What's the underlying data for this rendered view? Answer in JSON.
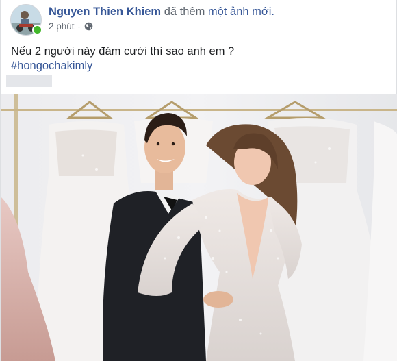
{
  "post": {
    "author": "Nguyen Thien Khiem",
    "action_verb": "đã thêm",
    "action_object": "một ảnh mới.",
    "time": "2 phút",
    "separator": "·",
    "privacy_icon": "globe-icon",
    "text": "Nếu 2 người này đám cưới thì sao anh em ?",
    "hashtag": "#hongochakimly",
    "photo_icon": "wedding-photo"
  },
  "colors": {
    "link": "#385898",
    "online": "#42b72a",
    "meta": "#606770"
  }
}
